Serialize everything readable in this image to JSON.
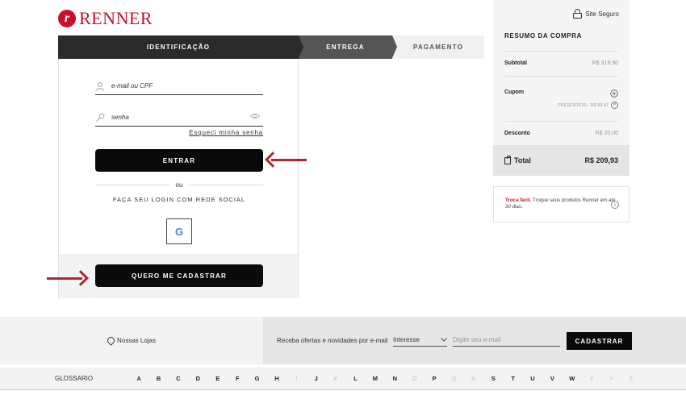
{
  "brand": {
    "name": "RENNER",
    "mark": "r"
  },
  "steps": [
    "IDENTIFICAÇÃO",
    "ENTREGA",
    "PAGAMENTO"
  ],
  "login": {
    "email_label": "e-mail ou CPF",
    "password_label": "senha",
    "forgot_link": "Esqueci minha senha",
    "enter_button": "ENTRAR",
    "or_text": "ou",
    "social_text": "FAÇA SEU LOGIN COM REDE SOCIAL",
    "google_label": "G",
    "register_button": "QUERO ME CADASTRAR"
  },
  "summary": {
    "secure_text": "Site Seguro",
    "title": "RESUMO DA COMPRA",
    "subtotal_label": "Subtotal",
    "subtotal_value": "R$ 319,90",
    "cupom_label": "Cupom",
    "coupon_code": "PRESENTE30 - R$ 89,97",
    "desconto_label": "Desconto",
    "desconto_value": "R$ 20,00",
    "total_label": "Total",
    "total_value": "R$ 209,93"
  },
  "troca": {
    "highlight": "Troca fácil.",
    "text": " Troque seus produtos Renner em até 30 dias."
  },
  "footer": {
    "stores": "Nossas Lojas",
    "offers_text": "Receba ofertas e novidades por e-mail",
    "interest_label": "Interesse",
    "email_placeholder": "Digite seu e-mail",
    "subscribe_button": "CADASTRAR",
    "glossary_label": "GLOSSARIO",
    "letters": [
      {
        "l": "A",
        "on": true
      },
      {
        "l": "B",
        "on": true
      },
      {
        "l": "C",
        "on": true
      },
      {
        "l": "D",
        "on": true
      },
      {
        "l": "E",
        "on": true
      },
      {
        "l": "F",
        "on": true
      },
      {
        "l": "G",
        "on": true
      },
      {
        "l": "H",
        "on": true
      },
      {
        "l": "I",
        "on": false
      },
      {
        "l": "J",
        "on": true
      },
      {
        "l": "K",
        "on": false
      },
      {
        "l": "L",
        "on": true
      },
      {
        "l": "M",
        "on": true
      },
      {
        "l": "N",
        "on": true
      },
      {
        "l": "O",
        "on": false
      },
      {
        "l": "P",
        "on": true
      },
      {
        "l": "Q",
        "on": false
      },
      {
        "l": "R",
        "on": false
      },
      {
        "l": "S",
        "on": true
      },
      {
        "l": "T",
        "on": true
      },
      {
        "l": "U",
        "on": true
      },
      {
        "l": "V",
        "on": true
      },
      {
        "l": "W",
        "on": true
      },
      {
        "l": "X",
        "on": false
      },
      {
        "l": "Y",
        "on": false
      },
      {
        "l": "Z",
        "on": false
      }
    ]
  },
  "colors": {
    "brand_red": "#c8102e",
    "arrow_red": "#b32431",
    "dark": "#0a0a0a"
  }
}
